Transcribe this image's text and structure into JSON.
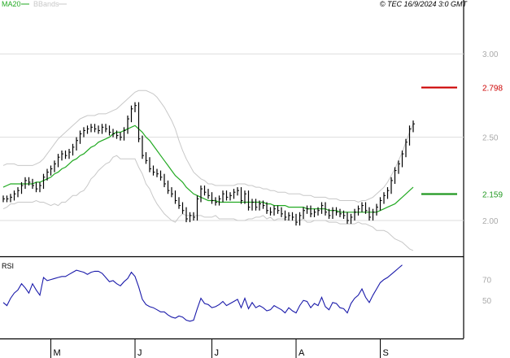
{
  "header": {
    "legend_ma": "MA20",
    "legend_bb": "BBands",
    "copyright": "© TEC 16/9/2024 3:0 GMT"
  },
  "colors": {
    "price": "#000000",
    "ma": "#22aa22",
    "bbands": "#c8c8c8",
    "rsi": "#1a1aaa",
    "resistance": "#cc0000",
    "support": "#229922",
    "grid": "#dddddd",
    "axis_text": "#aaaaaa",
    "panel_border": "#000000"
  },
  "chart_data": [
    {
      "type": "line",
      "name": "price-panel",
      "ylim": [
        1.8,
        3.25
      ],
      "yticks": [
        2.0,
        2.5,
        3.0
      ],
      "ytick_labels": [
        "2.00",
        "2.50",
        "3.00"
      ],
      "grid": true,
      "levels": [
        {
          "name": "resistance",
          "value": 2.798,
          "label": "2.798"
        },
        {
          "name": "support",
          "value": 2.159,
          "label": "2.159"
        }
      ],
      "x_months": [
        {
          "label": "M",
          "index": 13
        },
        {
          "label": "J",
          "index": 36
        },
        {
          "label": "J",
          "index": 57
        },
        {
          "label": "A",
          "index": 80
        },
        {
          "label": "S",
          "index": 103
        }
      ],
      "close": [
        2.13,
        2.13,
        2.14,
        2.16,
        2.18,
        2.21,
        2.24,
        2.23,
        2.21,
        2.19,
        2.21,
        2.26,
        2.29,
        2.31,
        2.34,
        2.38,
        2.4,
        2.39,
        2.41,
        2.44,
        2.48,
        2.52,
        2.54,
        2.55,
        2.56,
        2.55,
        2.54,
        2.56,
        2.55,
        2.53,
        2.52,
        2.51,
        2.5,
        2.54,
        2.61,
        2.67,
        2.69,
        2.49,
        2.39,
        2.36,
        2.31,
        2.29,
        2.28,
        2.26,
        2.22,
        2.18,
        2.16,
        2.12,
        2.09,
        2.06,
        2.01,
        2.03,
        2.02,
        2.13,
        2.19,
        2.17,
        2.15,
        2.12,
        2.11,
        2.13,
        2.16,
        2.14,
        2.15,
        2.17,
        2.18,
        2.12,
        2.16,
        2.08,
        2.11,
        2.08,
        2.1,
        2.09,
        2.06,
        2.05,
        2.07,
        2.06,
        2.04,
        2.02,
        2.03,
        2.02,
        1.99,
        2.03,
        2.06,
        2.07,
        2.04,
        2.05,
        2.06,
        2.09,
        2.05,
        2.03,
        2.06,
        2.05,
        2.04,
        2.03,
        2.0,
        2.02,
        2.05,
        2.07,
        2.09,
        2.06,
        2.02,
        2.05,
        2.08,
        2.12,
        2.15,
        2.18,
        2.24,
        2.3,
        2.34,
        2.4,
        2.47,
        2.55,
        2.58
      ],
      "ma20": [
        2.2,
        2.21,
        2.22,
        2.22,
        2.22,
        2.22,
        2.22,
        2.22,
        2.22,
        2.23,
        2.23,
        2.24,
        2.25,
        2.26,
        2.28,
        2.29,
        2.31,
        2.32,
        2.34,
        2.36,
        2.37,
        2.39,
        2.4,
        2.42,
        2.44,
        2.45,
        2.47,
        2.48,
        2.49,
        2.5,
        2.52,
        2.53,
        2.53,
        2.54,
        2.55,
        2.56,
        2.57,
        2.55,
        2.53,
        2.5,
        2.48,
        2.45,
        2.42,
        2.39,
        2.36,
        2.33,
        2.3,
        2.27,
        2.25,
        2.23,
        2.2,
        2.18,
        2.16,
        2.15,
        2.14,
        2.13,
        2.12,
        2.12,
        2.12,
        2.11,
        2.11,
        2.11,
        2.11,
        2.11,
        2.11,
        2.11,
        2.11,
        2.11,
        2.11,
        2.11,
        2.11,
        2.11,
        2.1,
        2.1,
        2.09,
        2.09,
        2.09,
        2.09,
        2.08,
        2.08,
        2.08,
        2.08,
        2.08,
        2.07,
        2.07,
        2.07,
        2.07,
        2.07,
        2.07,
        2.06,
        2.06,
        2.06,
        2.05,
        2.05,
        2.05,
        2.05,
        2.05,
        2.05,
        2.05,
        2.05,
        2.05,
        2.05,
        2.05,
        2.06,
        2.07,
        2.08,
        2.09,
        2.1,
        2.12,
        2.14,
        2.16,
        2.18,
        2.2
      ],
      "bb_upper": [
        2.33,
        2.34,
        2.34,
        2.34,
        2.33,
        2.33,
        2.33,
        2.33,
        2.33,
        2.34,
        2.35,
        2.37,
        2.4,
        2.43,
        2.46,
        2.49,
        2.51,
        2.53,
        2.55,
        2.57,
        2.59,
        2.61,
        2.62,
        2.63,
        2.63,
        2.63,
        2.64,
        2.64,
        2.64,
        2.65,
        2.66,
        2.67,
        2.69,
        2.71,
        2.73,
        2.75,
        2.77,
        2.78,
        2.78,
        2.78,
        2.77,
        2.76,
        2.74,
        2.71,
        2.68,
        2.64,
        2.6,
        2.55,
        2.48,
        2.42,
        2.37,
        2.33,
        2.29,
        2.27,
        2.25,
        2.24,
        2.22,
        2.22,
        2.21,
        2.21,
        2.21,
        2.21,
        2.21,
        2.21,
        2.22,
        2.22,
        2.22,
        2.21,
        2.21,
        2.2,
        2.2,
        2.19,
        2.19,
        2.18,
        2.18,
        2.17,
        2.17,
        2.17,
        2.16,
        2.16,
        2.16,
        2.16,
        2.15,
        2.15,
        2.15,
        2.14,
        2.14,
        2.14,
        2.14,
        2.13,
        2.13,
        2.13,
        2.12,
        2.12,
        2.12,
        2.12,
        2.12,
        2.11,
        2.12,
        2.12,
        2.13,
        2.14,
        2.16,
        2.18,
        2.2,
        2.23,
        2.27,
        2.31,
        2.36,
        2.41,
        2.47,
        2.53,
        2.58
      ],
      "bb_lower": [
        2.07,
        2.08,
        2.1,
        2.1,
        2.11,
        2.11,
        2.11,
        2.11,
        2.11,
        2.12,
        2.11,
        2.11,
        2.1,
        2.09,
        2.1,
        2.09,
        2.11,
        2.11,
        2.13,
        2.15,
        2.15,
        2.17,
        2.18,
        2.21,
        2.25,
        2.27,
        2.3,
        2.32,
        2.34,
        2.35,
        2.38,
        2.39,
        2.37,
        2.37,
        2.37,
        2.37,
        2.37,
        2.32,
        2.28,
        2.22,
        2.19,
        2.14,
        2.1,
        2.07,
        2.04,
        2.02,
        2.0,
        1.99,
        2.02,
        2.04,
        2.03,
        2.03,
        2.03,
        2.03,
        2.03,
        2.02,
        2.02,
        2.02,
        2.03,
        2.01,
        2.01,
        2.01,
        2.01,
        2.01,
        2.0,
        2.0,
        2.0,
        2.01,
        2.01,
        2.02,
        2.02,
        2.03,
        2.01,
        2.02,
        2.0,
        2.01,
        2.01,
        2.01,
        2.0,
        2.0,
        2.0,
        2.0,
        2.01,
        1.99,
        1.99,
        2.0,
        2.0,
        2.0,
        2.0,
        1.99,
        1.99,
        1.99,
        1.98,
        1.98,
        1.98,
        1.98,
        1.98,
        1.99,
        1.98,
        1.98,
        1.97,
        1.96,
        1.94,
        1.94,
        1.94,
        1.93,
        1.91,
        1.89,
        1.88,
        1.87,
        1.85,
        1.83,
        1.82
      ]
    },
    {
      "type": "line",
      "name": "RSI",
      "title": "RSI",
      "ylim": [
        15,
        90
      ],
      "yticks": [
        50,
        70
      ],
      "ytick_labels": [
        "50",
        "70"
      ],
      "values": [
        48,
        45,
        52,
        57,
        60,
        66,
        62,
        57,
        66,
        60,
        55,
        72,
        69,
        70,
        71,
        72,
        73,
        73,
        75,
        77,
        79,
        78,
        77,
        75,
        77,
        78,
        78,
        76,
        72,
        68,
        69,
        66,
        64,
        68,
        71,
        77,
        73,
        63,
        51,
        46,
        44,
        43,
        41,
        39,
        39,
        36,
        34,
        33,
        35,
        34,
        31,
        30,
        31,
        42,
        52,
        47,
        46,
        43,
        44,
        46,
        49,
        45,
        47,
        49,
        51,
        43,
        52,
        42,
        48,
        43,
        45,
        43,
        40,
        41,
        45,
        43,
        41,
        38,
        43,
        40,
        38,
        45,
        50,
        49,
        43,
        47,
        45,
        53,
        44,
        41,
        48,
        47,
        43,
        42,
        38,
        47,
        52,
        55,
        61,
        53,
        48,
        55,
        61,
        67,
        70,
        72,
        75,
        78,
        81,
        84
      ]
    }
  ]
}
